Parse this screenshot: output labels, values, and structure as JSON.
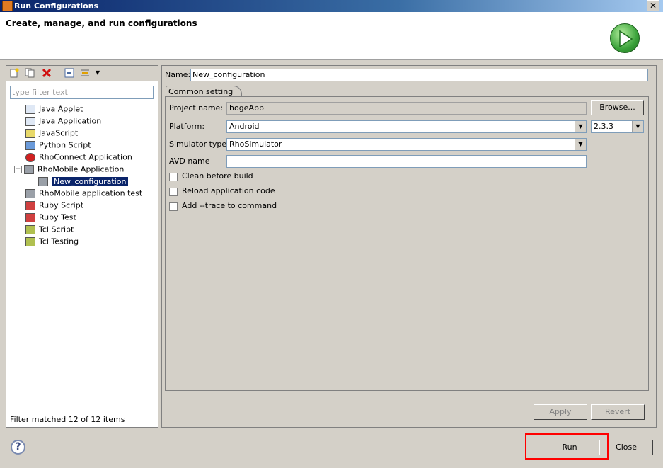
{
  "window": {
    "title": "Run Configurations",
    "close_glyph": "✕"
  },
  "header": {
    "title": "Create, manage, and run configurations",
    "icon": "run-play-icon"
  },
  "left_toolbar": {
    "icons": [
      "new-config-icon",
      "duplicate-icon",
      "delete-icon",
      "collapse-all-icon",
      "filter-icon",
      "dropdown-icon"
    ]
  },
  "filter": {
    "placeholder": "type filter text",
    "status": "Filter matched 12 of 12 items"
  },
  "tree": {
    "items": [
      {
        "label": "Java Applet",
        "icon": "java-applet-icon",
        "depth": 1
      },
      {
        "label": "Java Application",
        "icon": "java-app-icon",
        "depth": 1
      },
      {
        "label": "JavaScript",
        "icon": "javascript-icon",
        "depth": 1
      },
      {
        "label": "Python Script",
        "icon": "python-icon",
        "depth": 1
      },
      {
        "label": "RhoConnect Application",
        "icon": "rhoconnect-icon",
        "depth": 1
      },
      {
        "label": "RhoMobile Application",
        "icon": "rhomobile-icon",
        "depth": 1,
        "expanded": true
      },
      {
        "label": "New_configuration",
        "icon": "rhomobile-config-icon",
        "depth": 2,
        "selected": true
      },
      {
        "label": "RhoMobile application test",
        "icon": "rhomobile-test-icon",
        "depth": 1
      },
      {
        "label": "Ruby Script",
        "icon": "ruby-icon",
        "depth": 1
      },
      {
        "label": "Ruby Test",
        "icon": "ruby-test-icon",
        "depth": 1
      },
      {
        "label": "Tcl Script",
        "icon": "tcl-icon",
        "depth": 1
      },
      {
        "label": "Tcl Testing",
        "icon": "tcl-test-icon",
        "depth": 1
      }
    ]
  },
  "config": {
    "name_label": "Name:",
    "name_value": "New_configuration",
    "tab_label": "Common setting",
    "project_label": "Project name:",
    "project_value": "hogeApp",
    "browse_label": "Browse...",
    "platform_label": "Platform:",
    "platform_value": "Android",
    "version_value": "2.3.3",
    "simulator_label": "Simulator type:",
    "simulator_value": "RhoSimulator",
    "avd_label": "AVD name",
    "avd_value": "",
    "clean_label": "Clean before build",
    "reload_label": "Reload application code",
    "trace_label": "Add --trace to command",
    "dropdown_glyph": "▼"
  },
  "buttons": {
    "apply": "Apply",
    "revert": "Revert",
    "run": "Run",
    "close": "Close",
    "help": "?"
  }
}
